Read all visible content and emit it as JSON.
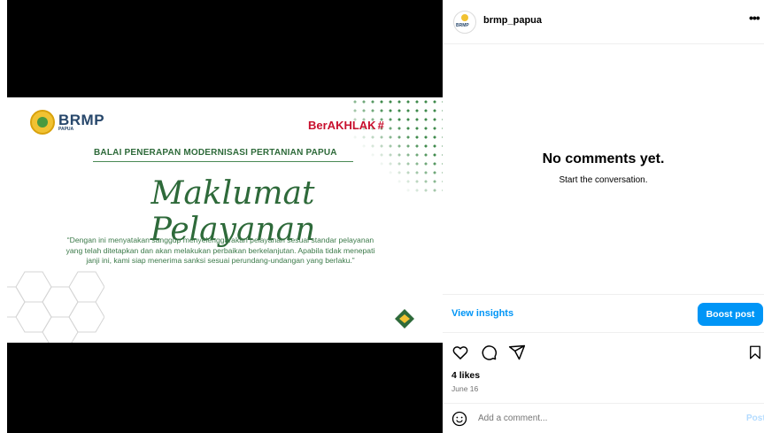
{
  "post_image": {
    "brand_name": "BRMP",
    "brand_sub": "PAPUA",
    "akhlak_text": "BerAKHLAK",
    "heading": "BALAI PENERAPAN MODERNISASI PERTANIAN PAPUA",
    "script_title": "Maklumat Pelayanan",
    "quote": "“Dengan ini menyatakan sanggup menyelenggarakan pelayanan sesuai standar pelayanan yang telah ditetapkan dan akan melakukan perbaikan berkelanjutan. Apabila tidak menepati janji ini, kami siap menerima sanksi sesuai perundang-undangan yang berlaku.”",
    "colors": {
      "green": "#2e6a3a",
      "navy": "#27476b",
      "red": "#c8102e"
    }
  },
  "header": {
    "username": "brmp_papua",
    "avatar_text": "BRMP",
    "more_icon": "more-horizontal-icon"
  },
  "comments": {
    "empty_title": "No comments yet.",
    "empty_subtitle": "Start the conversation."
  },
  "insights": {
    "view_label": "View insights",
    "boost_label": "Boost post",
    "accent": "#0095f6"
  },
  "actions": {
    "icons": [
      "heart-icon",
      "comment-icon",
      "share-icon",
      "bookmark-icon"
    ]
  },
  "stats": {
    "likes": "4 likes",
    "date": "June 16"
  },
  "composer": {
    "placeholder": "Add a comment...",
    "post_label": "Post",
    "emoji_icon": "emoji-icon"
  }
}
